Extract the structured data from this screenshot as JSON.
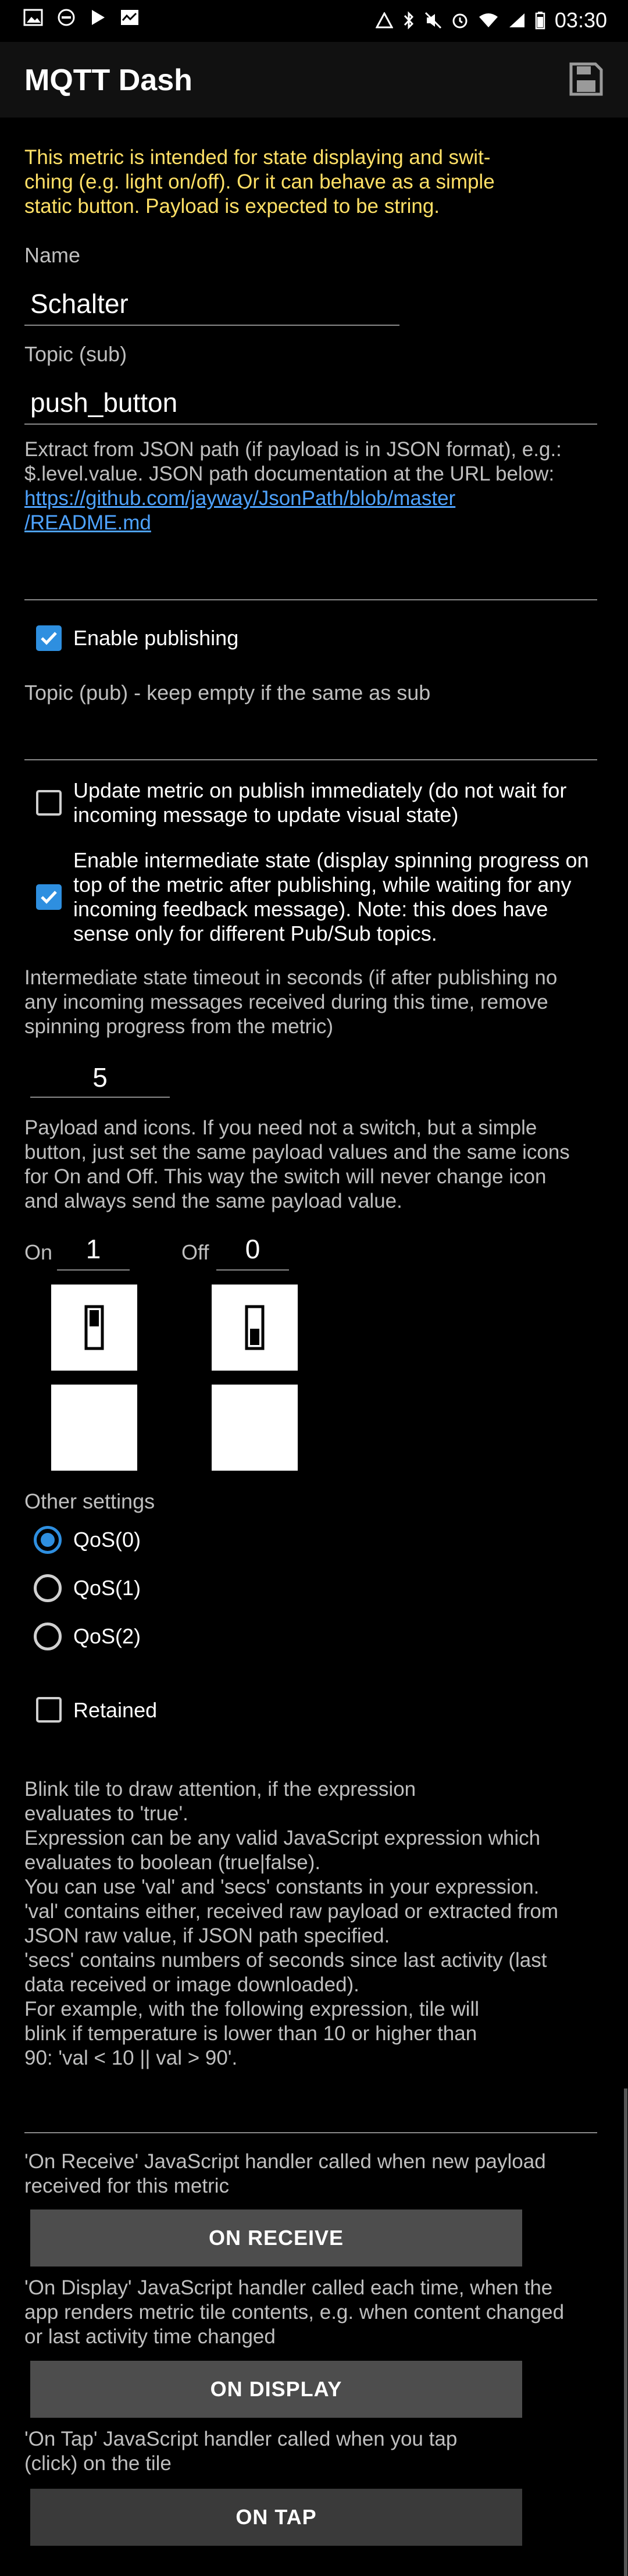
{
  "status_bar": {
    "time": "03:30"
  },
  "app": {
    "title": "MQTT Dash",
    "save_icon": "save-icon"
  },
  "intro": {
    "line1": "This metric is intended for state displaying and swit-",
    "line2": "ching (e.g. light on/off). Or it can behave as a simple",
    "line3": "static button. Payload is expected to be string."
  },
  "name": {
    "label": "Name",
    "value": "Schalter"
  },
  "topic_sub": {
    "label": "Topic (sub)",
    "value": "push_button"
  },
  "json_path": {
    "line1": "Extract from JSON path (if payload is in JSON format), e.g.:",
    "line2": "$.level.value. JSON path documentation at the URL below:",
    "link1": "https://github.com/jayway/JsonPath/blob/master",
    "link2": "/README.md",
    "value": ""
  },
  "enable_publishing": {
    "label": "Enable publishing",
    "checked": true
  },
  "topic_pub": {
    "label": "Topic (pub) - keep empty if the same as sub",
    "value": ""
  },
  "update_immediately": {
    "line1": "Update metric on publish immediately (do not wait for",
    "line2": "incoming message to update visual state)",
    "checked": false
  },
  "intermediate_state": {
    "line1": "Enable intermediate state (display spinning progress on",
    "line2": "top of the metric after publishing, while waiting for any",
    "line3": "incoming feedback message). Note: this does have",
    "line4": "sense only for different Pub/Sub topics.",
    "checked": true
  },
  "timeout": {
    "line1": "Intermediate state timeout in seconds (if after publishing no",
    "line2": "any incoming messages received during this time, remove",
    "line3": "spinning progress from the metric)",
    "value": "5"
  },
  "payload": {
    "line1": "Payload and icons. If you need not a switch, but a simple",
    "line2": "button, just set the same payload values and the same icons",
    "line3": "for On and Off. This way the switch will never change icon",
    "line4": "and always send the same payload value.",
    "on_label": "On",
    "on_value": "1",
    "off_label": "Off",
    "off_value": "0"
  },
  "other": {
    "label": "Other settings",
    "qos": [
      "QoS(0)",
      "QoS(1)",
      "QoS(2)"
    ],
    "qos_selected": 0,
    "retained_label": "Retained",
    "retained_checked": false
  },
  "blink": {
    "lines": [
      "Blink tile to draw attention, if the expression",
      "evaluates to 'true'.",
      "Expression can be any valid JavaScript expression which",
      "evaluates to boolean (true|false).",
      "You can use 'val' and 'secs' constants in your expression.",
      "'val' contains either, received raw payload or extracted from",
      "JSON raw value, if JSON path specified.",
      "'secs' contains numbers of seconds since last activity (last",
      "data received or image downloaded).",
      "For example, with the following expression, tile will",
      "blink if temperature is lower than 10 or higher than",
      "90: 'val < 10 || val > 90'."
    ],
    "value": ""
  },
  "handlers": {
    "on_receive_line1": "'On Receive' JavaScript handler called when new payload",
    "on_receive_line2": "received for this metric",
    "on_receive_button": "ON RECEIVE",
    "on_display_line1": "'On Display' JavaScript handler called each time, when the",
    "on_display_line2": "app renders metric tile contents, e.g. when content changed",
    "on_display_line3": "or last activity time changed",
    "on_display_button": "ON DISPLAY",
    "on_tap_line1": "'On Tap' JavaScript handler called when you tap",
    "on_tap_line2": "(click) on the tile",
    "on_tap_button": "ON TAP"
  },
  "colors": {
    "accent": "#2e8fe0",
    "intro_text": "#ffe066",
    "link": "#4ea3ff",
    "button_bg": "#4d4d4d"
  }
}
